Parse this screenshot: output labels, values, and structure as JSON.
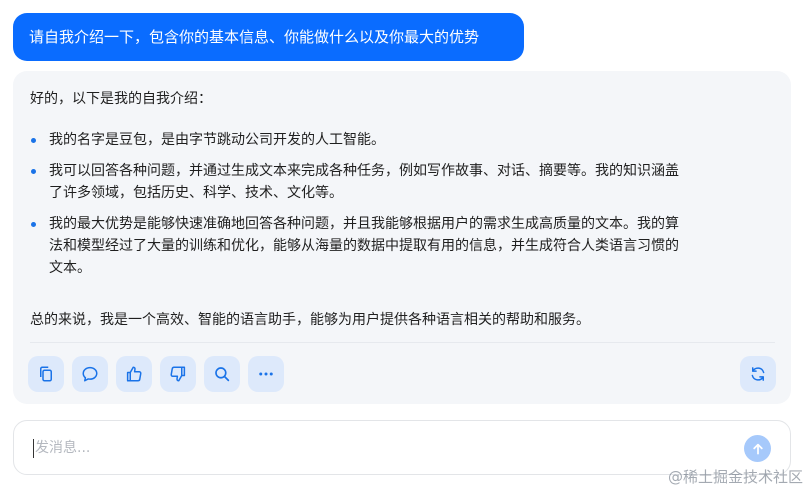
{
  "user_message": "请自我介绍一下，包含你的基本信息、你能做什么以及你最大的优势",
  "assistant": {
    "intro": "好的，以下是我的自我介绍：",
    "bullets": [
      "我的名字是豆包，是由字节跳动公司开发的人工智能。",
      "我可以回答各种问题，并通过生成文本来完成各种任务，例如写作故事、对话、摘要等。我的知识涵盖\n了许多领域，包括历史、科学、技术、文化等。",
      "我的最大优势是能够快速准确地回答各种问题，并且我能够根据用户的需求生成高质量的文本。我的算\n法和模型经过了大量的训练和优化，能够从海量的数据中提取有用的信息，并生成符合人类语言习惯的\n文本。"
    ],
    "summary": "总的来说，我是一个高效、智能的语言助手，能够为用户提供各种语言相关的帮助和服务。",
    "actions": [
      "copy-icon",
      "comment-icon",
      "thumbs-up-icon",
      "thumbs-down-icon",
      "search-icon",
      "more-icon"
    ],
    "refresh_icon": "refresh-icon"
  },
  "input": {
    "placeholder": "发消息...",
    "value": ""
  },
  "send_icon": "arrow-up-icon",
  "watermark": "@稀土掘金技术社区",
  "colors": {
    "user_bubble": "#0a6cff",
    "card_bg": "#f4f6f9",
    "action_bg": "#dde9fb",
    "icon": "#1a73e8",
    "send_bg": "#a6c9fb"
  }
}
